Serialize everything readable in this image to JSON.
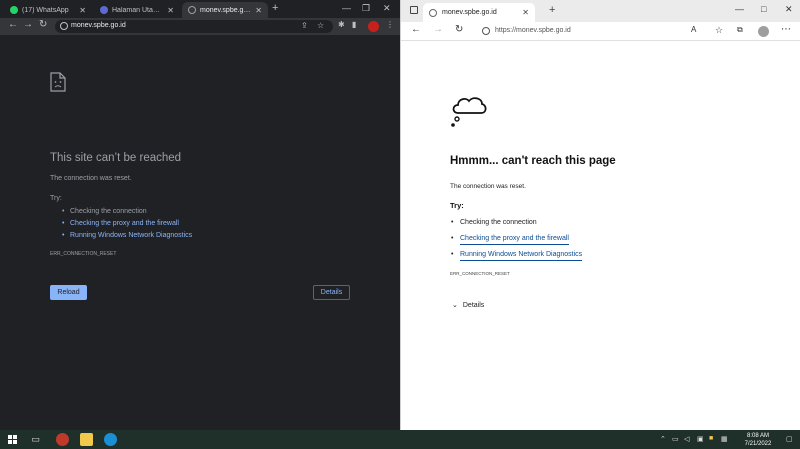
{
  "chrome": {
    "tabs": [
      {
        "title": "(17) WhatsApp",
        "favicon_color": "#25d366"
      },
      {
        "title": "Halaman Utama Ecr",
        "favicon_color": "#5e6ad2"
      },
      {
        "title": "monev.spbe.go.id",
        "favicon_color": "#9aa0a6"
      }
    ],
    "new_tab": "+",
    "url": "monev.spbe.go.id",
    "error": {
      "title": "This site can’t be reached",
      "message": "The connection was reset.",
      "try_label": "Try:",
      "suggestions": [
        "Checking the connection",
        "Checking the proxy and the firewall",
        "Running Windows Network Diagnostics"
      ],
      "code": "ERR_CONNECTION_RESET",
      "reload_label": "Reload",
      "details_label": "Details"
    }
  },
  "edge": {
    "tab_title": "monev.spbe.go.id",
    "new_tab": "+",
    "url": "https://monev.spbe.go.id",
    "error": {
      "title": "Hmmm... can't reach this page",
      "message": "The connection was reset.",
      "try_label": "Try:",
      "suggestions": [
        "Checking the connection",
        "Checking the proxy and the firewall",
        "Running Windows Network Diagnostics"
      ],
      "code": "ERR_CONNECTION_RESET",
      "details_label": "Details"
    }
  },
  "taskbar": {
    "time": "8:08 AM",
    "date": "7/21/2022"
  },
  "colors": {
    "chrome_bg": "#202124",
    "chrome_link": "#8ab4f8",
    "edge_link": "#0c4d95",
    "taskbar_bg": "#1f2f2a"
  }
}
